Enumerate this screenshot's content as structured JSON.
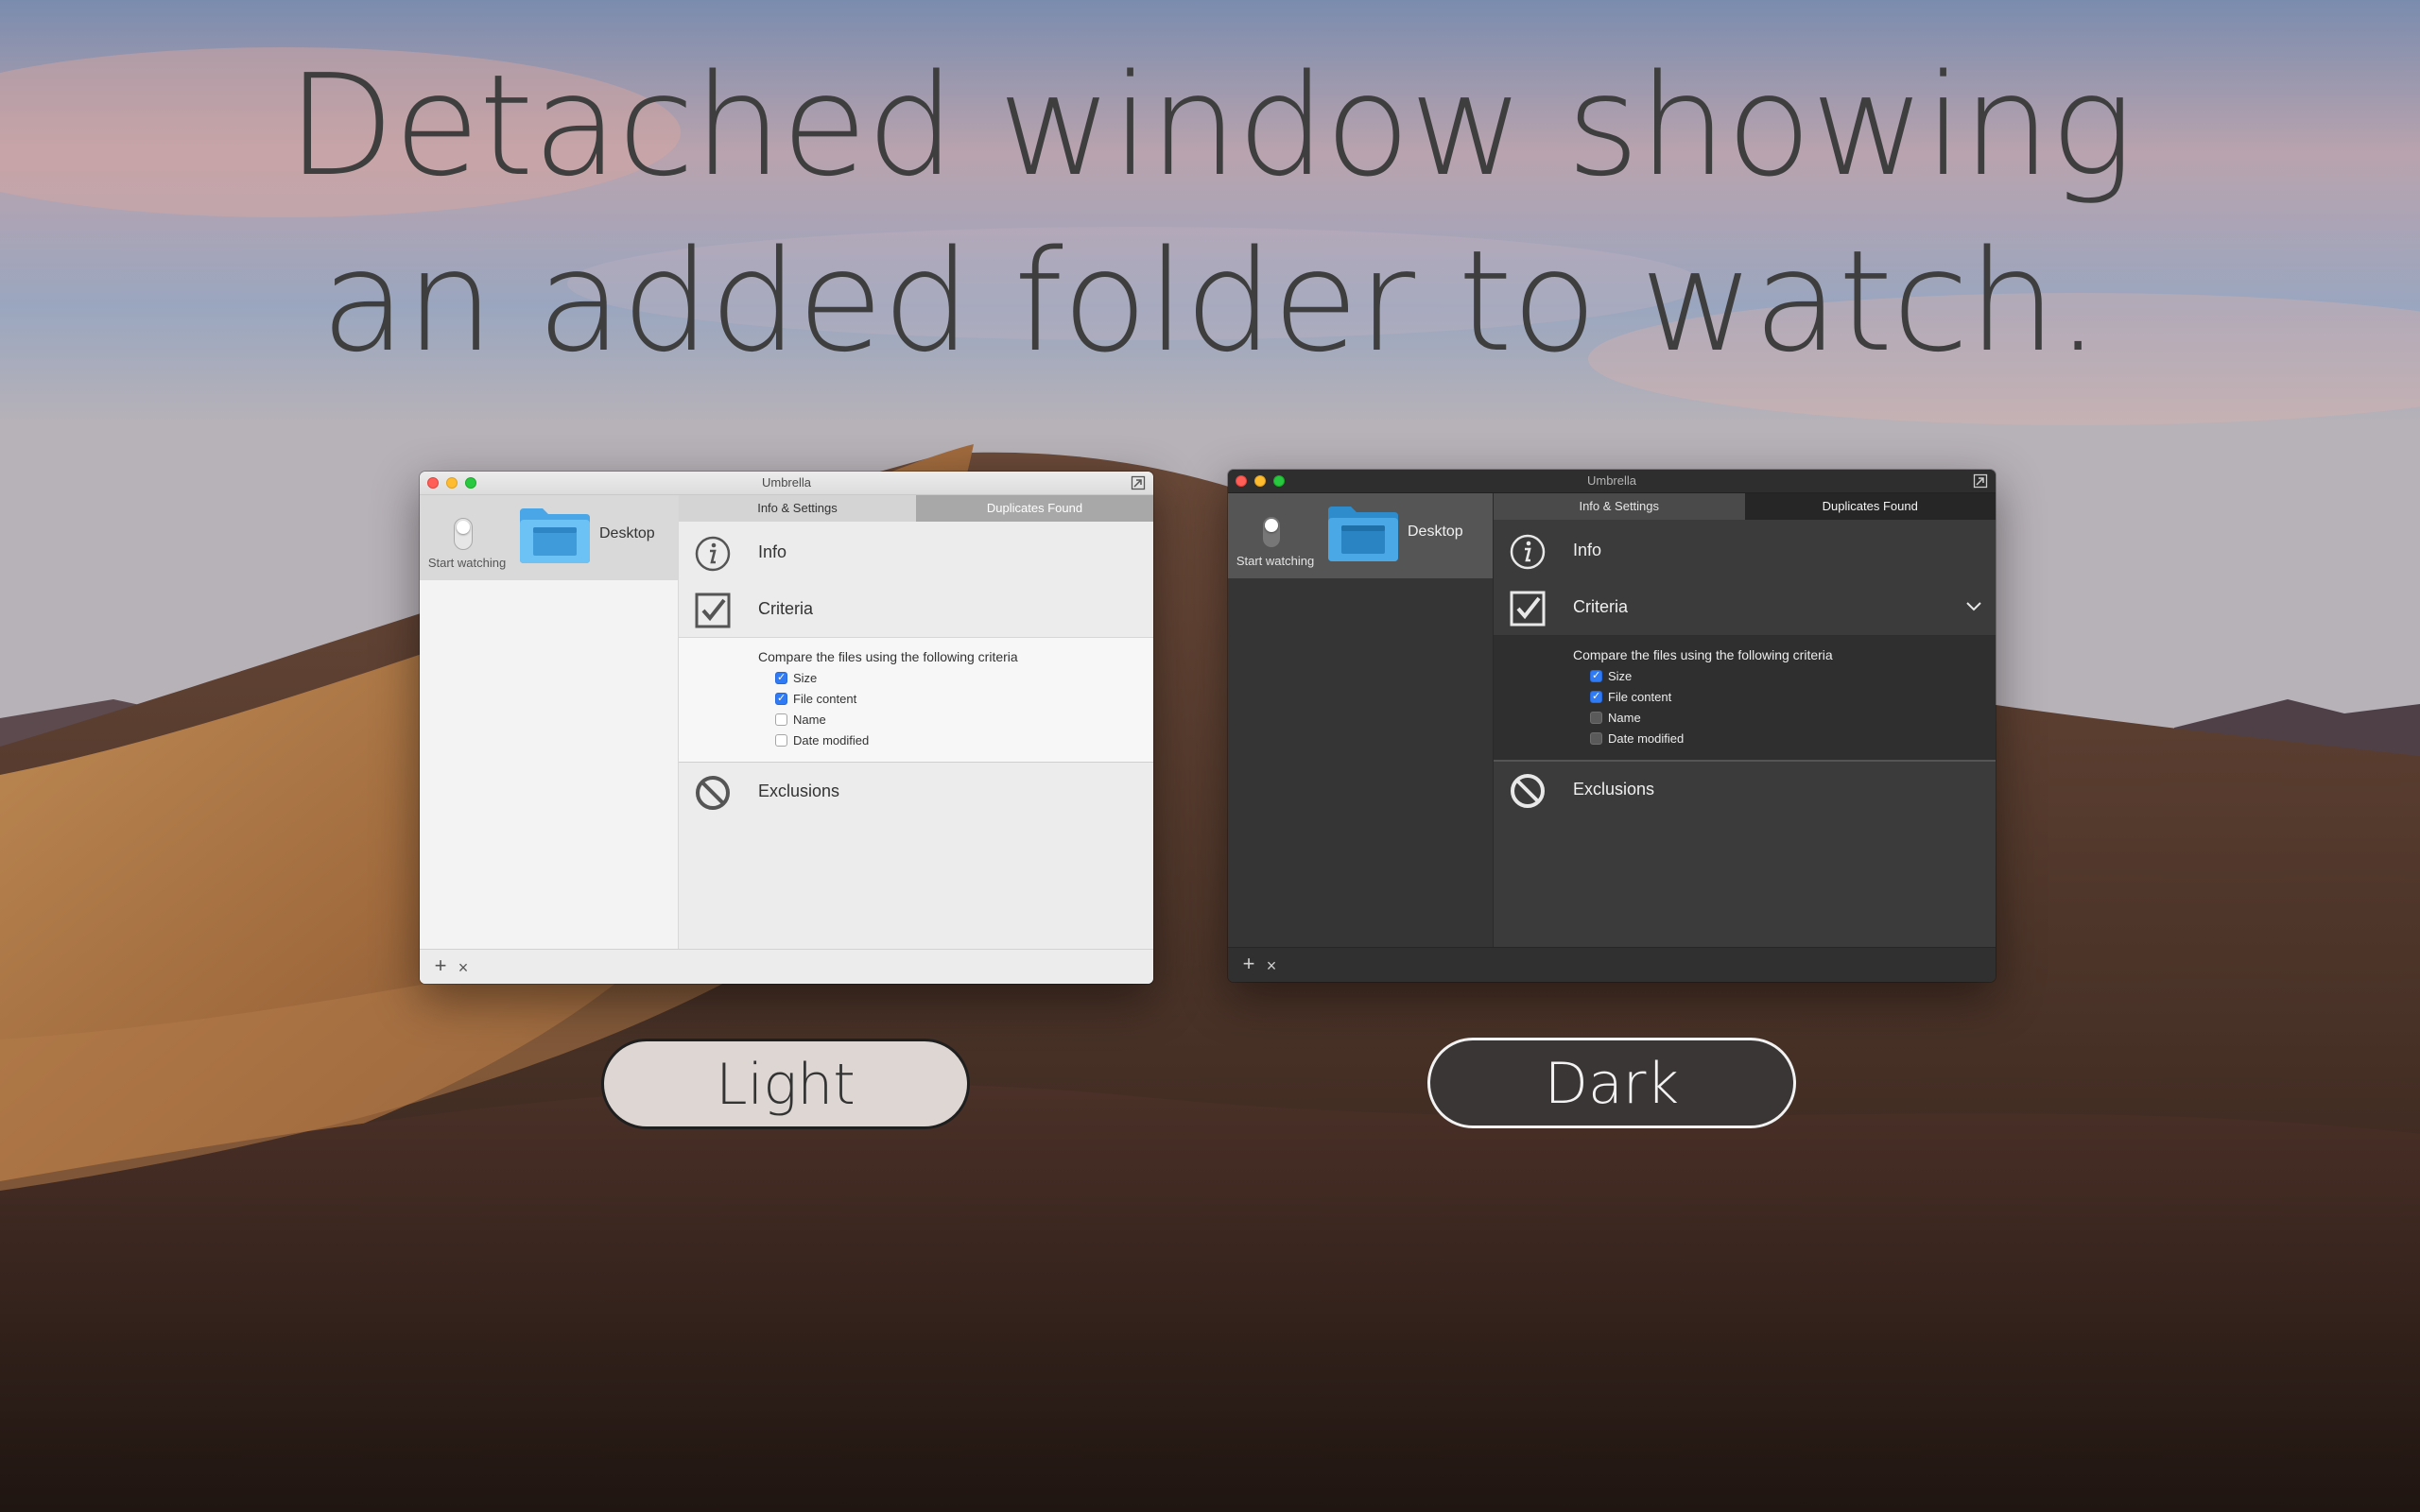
{
  "headline": {
    "line1": "Detached window showing",
    "line2": "an added folder to watch."
  },
  "windows": {
    "light": {
      "title": "Umbrella",
      "folder": {
        "name": "Desktop",
        "toggle_label": "Start watching"
      },
      "tabs": [
        "Info & Settings",
        "Duplicates Found"
      ],
      "sections": {
        "info": "Info",
        "criteria": "Criteria",
        "exclusions": "Exclusions"
      },
      "criteria": {
        "heading": "Compare the files using the following criteria",
        "options": [
          {
            "label": "Size",
            "checked": true
          },
          {
            "label": "File content",
            "checked": true
          },
          {
            "label": "Name",
            "checked": false
          },
          {
            "label": "Date modified",
            "checked": false
          }
        ]
      },
      "bottom": {
        "add": "+",
        "remove": "×"
      }
    },
    "dark": {
      "title": "Umbrella",
      "folder": {
        "name": "Desktop",
        "toggle_label": "Start watching"
      },
      "tabs": [
        "Info & Settings",
        "Duplicates Found"
      ],
      "sections": {
        "info": "Info",
        "criteria": "Criteria",
        "exclusions": "Exclusions"
      },
      "criteria": {
        "heading": "Compare the files using the following criteria",
        "options": [
          {
            "label": "Size",
            "checked": true
          },
          {
            "label": "File content",
            "checked": true
          },
          {
            "label": "Name",
            "checked": false
          },
          {
            "label": "Date modified",
            "checked": false
          }
        ]
      },
      "bottom": {
        "add": "+",
        "remove": "×"
      }
    }
  },
  "theme_buttons": {
    "light": "Light",
    "dark": "Dark"
  },
  "colors": {
    "accent": "#2f7bf5",
    "traffic_close": "#ff5f57",
    "traffic_minimize": "#febc2e",
    "traffic_maximize": "#28c840",
    "folder_blue": "#5db7ef"
  },
  "icons": {
    "info": "info-circle-icon",
    "criteria": "checkmark-box-icon",
    "exclusions": "prohibited-icon",
    "folder": "folder-icon",
    "detach": "detach-window-icon",
    "expand": "chevron-down-icon"
  }
}
